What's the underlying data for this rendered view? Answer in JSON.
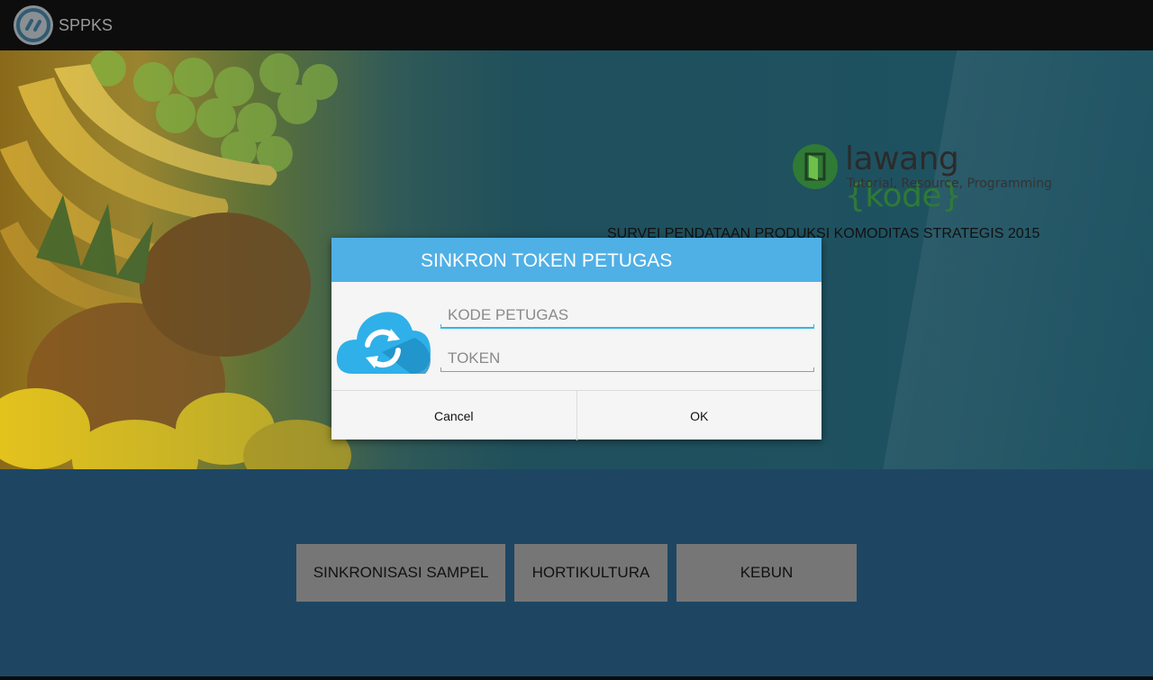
{
  "app": {
    "title": "SPPKS",
    "icon": "sync-code-icon"
  },
  "hero": {
    "logo_name": "lawang",
    "logo_brace_open": "{",
    "logo_kode": "kode",
    "logo_brace_close": "}",
    "logo_tagline": "Tutorial, Resource, Programming",
    "survey_title": "SURVEI PENDATAAN PRODUKSI KOMODITAS STRATEGIS 2015"
  },
  "dialog": {
    "title": "SINKRON TOKEN PETUGAS",
    "icon": "cloud-sync-icon",
    "fields": {
      "kode_petugas": {
        "placeholder": "KODE PETUGAS",
        "value": ""
      },
      "token": {
        "placeholder": "TOKEN",
        "value": ""
      }
    },
    "cancel_label": "Cancel",
    "ok_label": "OK"
  },
  "menu": {
    "sinkronisasi_label": "SINKRONISASI SAMPEL",
    "hortikultura_label": "HORTIKULTURA",
    "kebun_label": "KEBUN"
  },
  "colors": {
    "action_bar": "#0d0d0d",
    "dialog_header": "#4fb0e6",
    "background": "#1e4663",
    "menu_button": "#767676",
    "focus_accent": "#33b5e5",
    "logo_green": "#2f7a35"
  }
}
